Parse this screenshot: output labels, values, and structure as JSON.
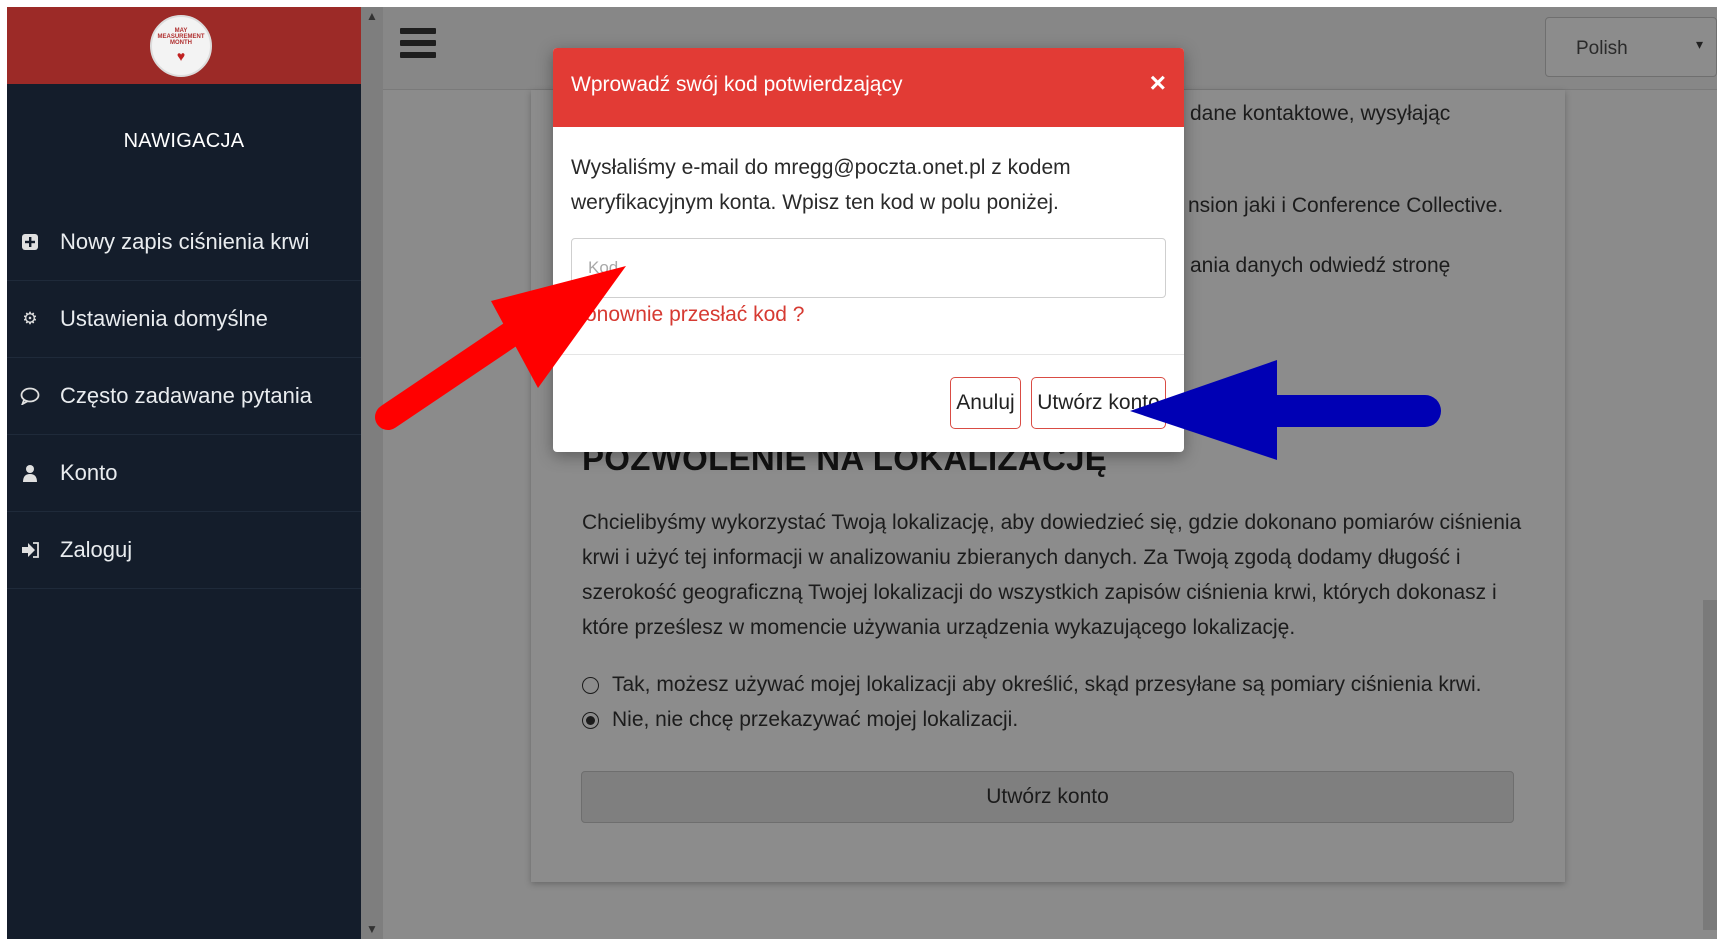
{
  "sidebar": {
    "logo_lines": [
      "MAY",
      "MEASUREMENT",
      "MONTH"
    ],
    "heading": "NAWIGACJA",
    "items": [
      {
        "label": "Nowy zapis ciśnienia krwi",
        "icon": "plus-square-icon"
      },
      {
        "label": "Ustawienia domyślne",
        "icon": "gear-icon"
      },
      {
        "label": "Często zadawane pytania",
        "icon": "speech-bubble-icon"
      },
      {
        "label": "Konto",
        "icon": "user-icon"
      },
      {
        "label": "Zaloguj",
        "icon": "sign-in-icon"
      }
    ]
  },
  "topbar": {
    "language": "Polish"
  },
  "background_page": {
    "snippet1": "dane kontaktowe, wysyłając",
    "snippet2": "nsion jaki i Conference Collective.",
    "snippet3": "ania danych odwiedź stronę",
    "location_title": "POZWOLENIE NA LOKALIZACJĘ",
    "location_text": "Chcielibyśmy wykorzystać Twoją lokalizację, aby dowiedzieć się, gdzie dokonano pomiarów ciśnienia krwi i użyć tej informacji w analizowaniu zbieranych danych. Za Twoją zgodą dodamy długość i szerokość geograficzną Twojej lokalizacji do wszystkich zapisów ciśnienia krwi, których dokonasz i które prześlesz w momencie używania urządzenia wykazującego lokalizację.",
    "radio_yes": "Tak, możesz używać mojej lokalizacji aby określić, skąd przesyłane są pomiary ciśnienia krwi.",
    "radio_no": "Nie, nie chcę przekazywać mojej lokalizacji.",
    "selected_radio": "no",
    "create_button": "Utwórz konto"
  },
  "modal": {
    "title": "Wprowadź swój kod potwierdzający",
    "close_symbol": "×",
    "message": "Wysłaliśmy e-mail do mregg@poczta.onet.pl z kodem weryfikacyjnym konta. Wpisz ten kod w polu poniżej.",
    "code_placeholder": "Kod",
    "resend_link": "Ponownie przesłać kod ?",
    "cancel_button": "Anuluj",
    "create_button": "Utwórz konto"
  },
  "annotations": {
    "red_arrow_color": "#ff0000",
    "blue_arrow_color": "#0000b4"
  }
}
